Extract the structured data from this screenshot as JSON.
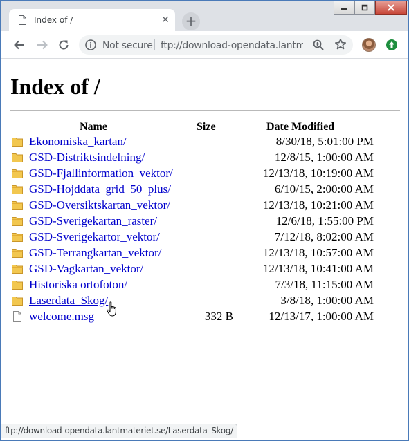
{
  "tab": {
    "title": "Index of /",
    "close_glyph": "✕",
    "new_tab_glyph": "+"
  },
  "toolbar": {
    "security_label": "Not secure",
    "url": "ftp://download-opendata.lantm..."
  },
  "page": {
    "heading": "Index of /",
    "columns": {
      "name": "Name",
      "size": "Size",
      "date": "Date Modified"
    },
    "entries": [
      {
        "type": "folder",
        "name": "Ekonomiska_kartan/",
        "size": "",
        "date": "8/30/18, 5:01:00 PM"
      },
      {
        "type": "folder",
        "name": "GSD-Distriktsindelning/",
        "size": "",
        "date": "12/8/15, 1:00:00 AM"
      },
      {
        "type": "folder",
        "name": "GSD-Fjallinformation_vektor/",
        "size": "",
        "date": "12/13/18, 10:19:00 AM"
      },
      {
        "type": "folder",
        "name": "GSD-Hojddata_grid_50_plus/",
        "size": "",
        "date": "6/10/15, 2:00:00 AM"
      },
      {
        "type": "folder",
        "name": "GSD-Oversiktskartan_vektor/",
        "size": "",
        "date": "12/13/18, 10:21:00 AM"
      },
      {
        "type": "folder",
        "name": "GSD-Sverigekartan_raster/",
        "size": "",
        "date": "12/6/18, 1:55:00 PM"
      },
      {
        "type": "folder",
        "name": "GSD-Sverigekartor_vektor/",
        "size": "",
        "date": "7/12/18, 8:02:00 AM"
      },
      {
        "type": "folder",
        "name": "GSD-Terrangkartan_vektor/",
        "size": "",
        "date": "12/13/18, 10:57:00 AM"
      },
      {
        "type": "folder",
        "name": "GSD-Vagkartan_vektor/",
        "size": "",
        "date": "12/13/18, 10:41:00 AM"
      },
      {
        "type": "folder",
        "name": "Historiska ortofoton/",
        "size": "",
        "date": "7/3/18, 11:15:00 AM"
      },
      {
        "type": "folder",
        "name": "Laserdata_Skog/",
        "size": "",
        "date": "3/8/18, 1:00:00 AM"
      },
      {
        "type": "file",
        "name": "welcome.msg",
        "size": "332 B",
        "date": "12/13/17, 1:00:00 AM"
      }
    ]
  },
  "status_bar": {
    "text": "ftp://download-opendata.lantmateriet.se/Laserdata_Skog/"
  },
  "colors": {
    "link": "#0000cc",
    "folder": "#e8b53a",
    "tab_strip": "#dee1e6"
  }
}
